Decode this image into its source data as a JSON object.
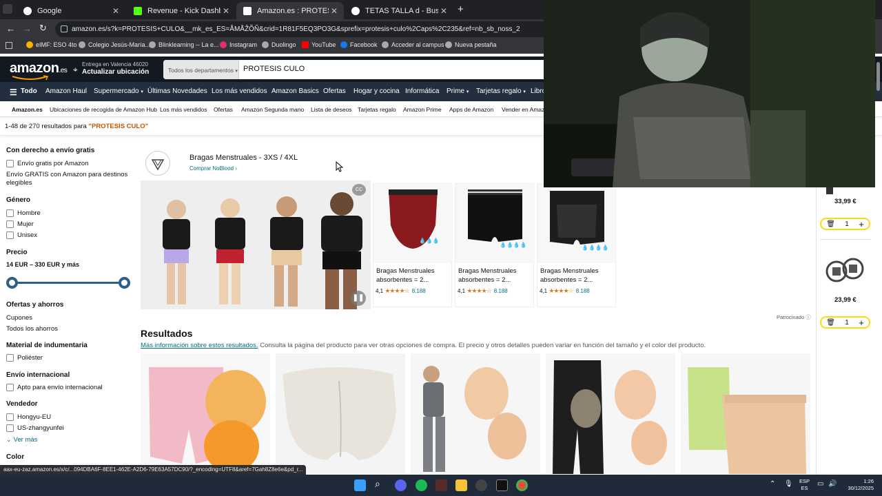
{
  "browser": {
    "tabs": [
      {
        "title": "Google",
        "favicon_color": "#ffffff",
        "active": false
      },
      {
        "title": "Revenue - Kick Dashboard",
        "favicon_color": "#53fc18",
        "active": false
      },
      {
        "title": "Amazon.es : PROTESIS CULO",
        "favicon_color": "#ffffff",
        "active": true
      },
      {
        "title": "TETAS TALLA d - Buscar con Go",
        "favicon_color": "#ffffff",
        "active": false
      }
    ],
    "new_tab": "+",
    "url": "amazon.es/s?k=PROTESIS+CULO&__mk_es_ES=ÅMÅŽÕÑ&crid=1R81F5EQ3PO3G&sprefix=protesis+culo%2Caps%2C235&ref=nb_sb_noss_2",
    "bookmarks": [
      {
        "label": "eIMF: ESO 4to",
        "color": "#f4b400"
      },
      {
        "label": "Colegio Jesús-María...",
        "color": "#aaaaaa"
      },
      {
        "label": "Blinklearning -- La e...",
        "color": "#aaaaaa"
      },
      {
        "label": "Instagram",
        "color": "#e1306c"
      },
      {
        "label": "Duolingo",
        "color": "#aaaaaa"
      },
      {
        "label": "YouTube",
        "color": "#ff0000"
      },
      {
        "label": "Facebook",
        "color": "#1877f2"
      },
      {
        "label": "Acceder al campus",
        "color": "#aaaaaa"
      },
      {
        "label": "Nueva pestaña",
        "color": "#aaaaaa"
      }
    ]
  },
  "amazon": {
    "logo": "amazon",
    "logo_suffix": ".es",
    "deliver_line1": "Entrega en Valencia 46020",
    "deliver_line2": "Actualizar ubicación",
    "search_dept": "Todos los departamentos",
    "search_value": "PROTESIS CULO",
    "nav": [
      {
        "label": "Todo",
        "menu": false
      },
      {
        "label": "Amazon Haul",
        "menu": false
      },
      {
        "label": "Supermercado",
        "menu": true
      },
      {
        "label": "Últimas Novedades",
        "menu": false
      },
      {
        "label": "Los más vendidos",
        "menu": false
      },
      {
        "label": "Amazon Basics",
        "menu": false
      },
      {
        "label": "Ofertas",
        "menu": false
      },
      {
        "label": "Hogar y cocina",
        "menu": false
      },
      {
        "label": "Informática",
        "menu": false
      },
      {
        "label": "Prime",
        "menu": true
      },
      {
        "label": "Tarjetas regalo",
        "menu": true
      },
      {
        "label": "Libro",
        "menu": false
      }
    ],
    "subnav": [
      "Amazon.es",
      "Ubicaciones de recogida de Amazon Hub",
      "Los más vendidos",
      "Ofertas",
      "Amazon Segunda mano",
      "Lista de deseos",
      "Tarjetas regalo",
      "Amazon Prime",
      "Apps de Amazon",
      "Vender en Amazo"
    ],
    "results_count": "1-48 de 270 resultados para ",
    "results_query": "\"PROTESIS CULO\""
  },
  "sidebar": {
    "shipping_heading": "Con derecho a envío gratis",
    "shipping_option": "Envío gratis por Amazon",
    "shipping_note": "Envío GRATIS con Amazon para destinos elegibles",
    "gender_heading": "Género",
    "genders": [
      "Hombre",
      "Mujer",
      "Unisex"
    ],
    "price_heading": "Precio",
    "price_range": "14 EUR – 330 EUR y más",
    "deals_heading": "Ofertas y ahorros",
    "deals": [
      "Cupones",
      "Todos los ahorros"
    ],
    "material_heading": "Material de indumentaria",
    "material": "Poliéster",
    "intl_heading": "Envío internacional",
    "intl": "Apto para envío internacional",
    "seller_heading": "Vendedor",
    "sellers": [
      "Hongyu-EU",
      "US-zhangyunfei"
    ],
    "see_more": "Ver más",
    "color_heading": "Color"
  },
  "sponsored": {
    "brand_title": "Bragas Menstruales - 3XS / 4XL",
    "brand_link": "Comprar NoBlood",
    "products": [
      {
        "name": "Bragas Menstruales absorbentes = 2...",
        "rating": "4,1",
        "stars": "★★★★☆",
        "count": "8.188",
        "color": "#8b1a1f",
        "drops": "💧💧💧"
      },
      {
        "name": "Bragas Menstruales absorbentes = 2...",
        "rating": "4,1",
        "stars": "★★★★☆",
        "count": "8.188",
        "color": "#111111",
        "drops": "💧💧💧💧"
      },
      {
        "name": "Bragas Menstruales absorbentes = 2...",
        "rating": "4,1",
        "stars": "★★★★☆",
        "count": "8.188",
        "color": "#1d1d1d",
        "drops": "💧💧💧💧"
      }
    ],
    "label": "Patrocinado"
  },
  "results": {
    "heading": "Resultados",
    "info_link": "Más información sobre estos resultados.",
    "info_text": " Consulta la página del producto para ver otras opciones de compra. El precio y otros detalles pueden variar en función del tamaño y el color del producto."
  },
  "cart": {
    "items": [
      {
        "price": "33,99 €",
        "qty": "1"
      },
      {
        "price": "23,99 €",
        "qty": "1"
      }
    ]
  },
  "status_url": "aax-eu-zaz.amazon.es/x/c/...094DBA6F-8EE1-462E-A2D6-79E63A57DC90/?_encoding=UTF8&aref=7Gah8Z8e6e&pd_r...",
  "taskbar": {
    "lang1": "ESP",
    "lang2": "ES",
    "time": "1:26",
    "date": "30/12/2025"
  }
}
